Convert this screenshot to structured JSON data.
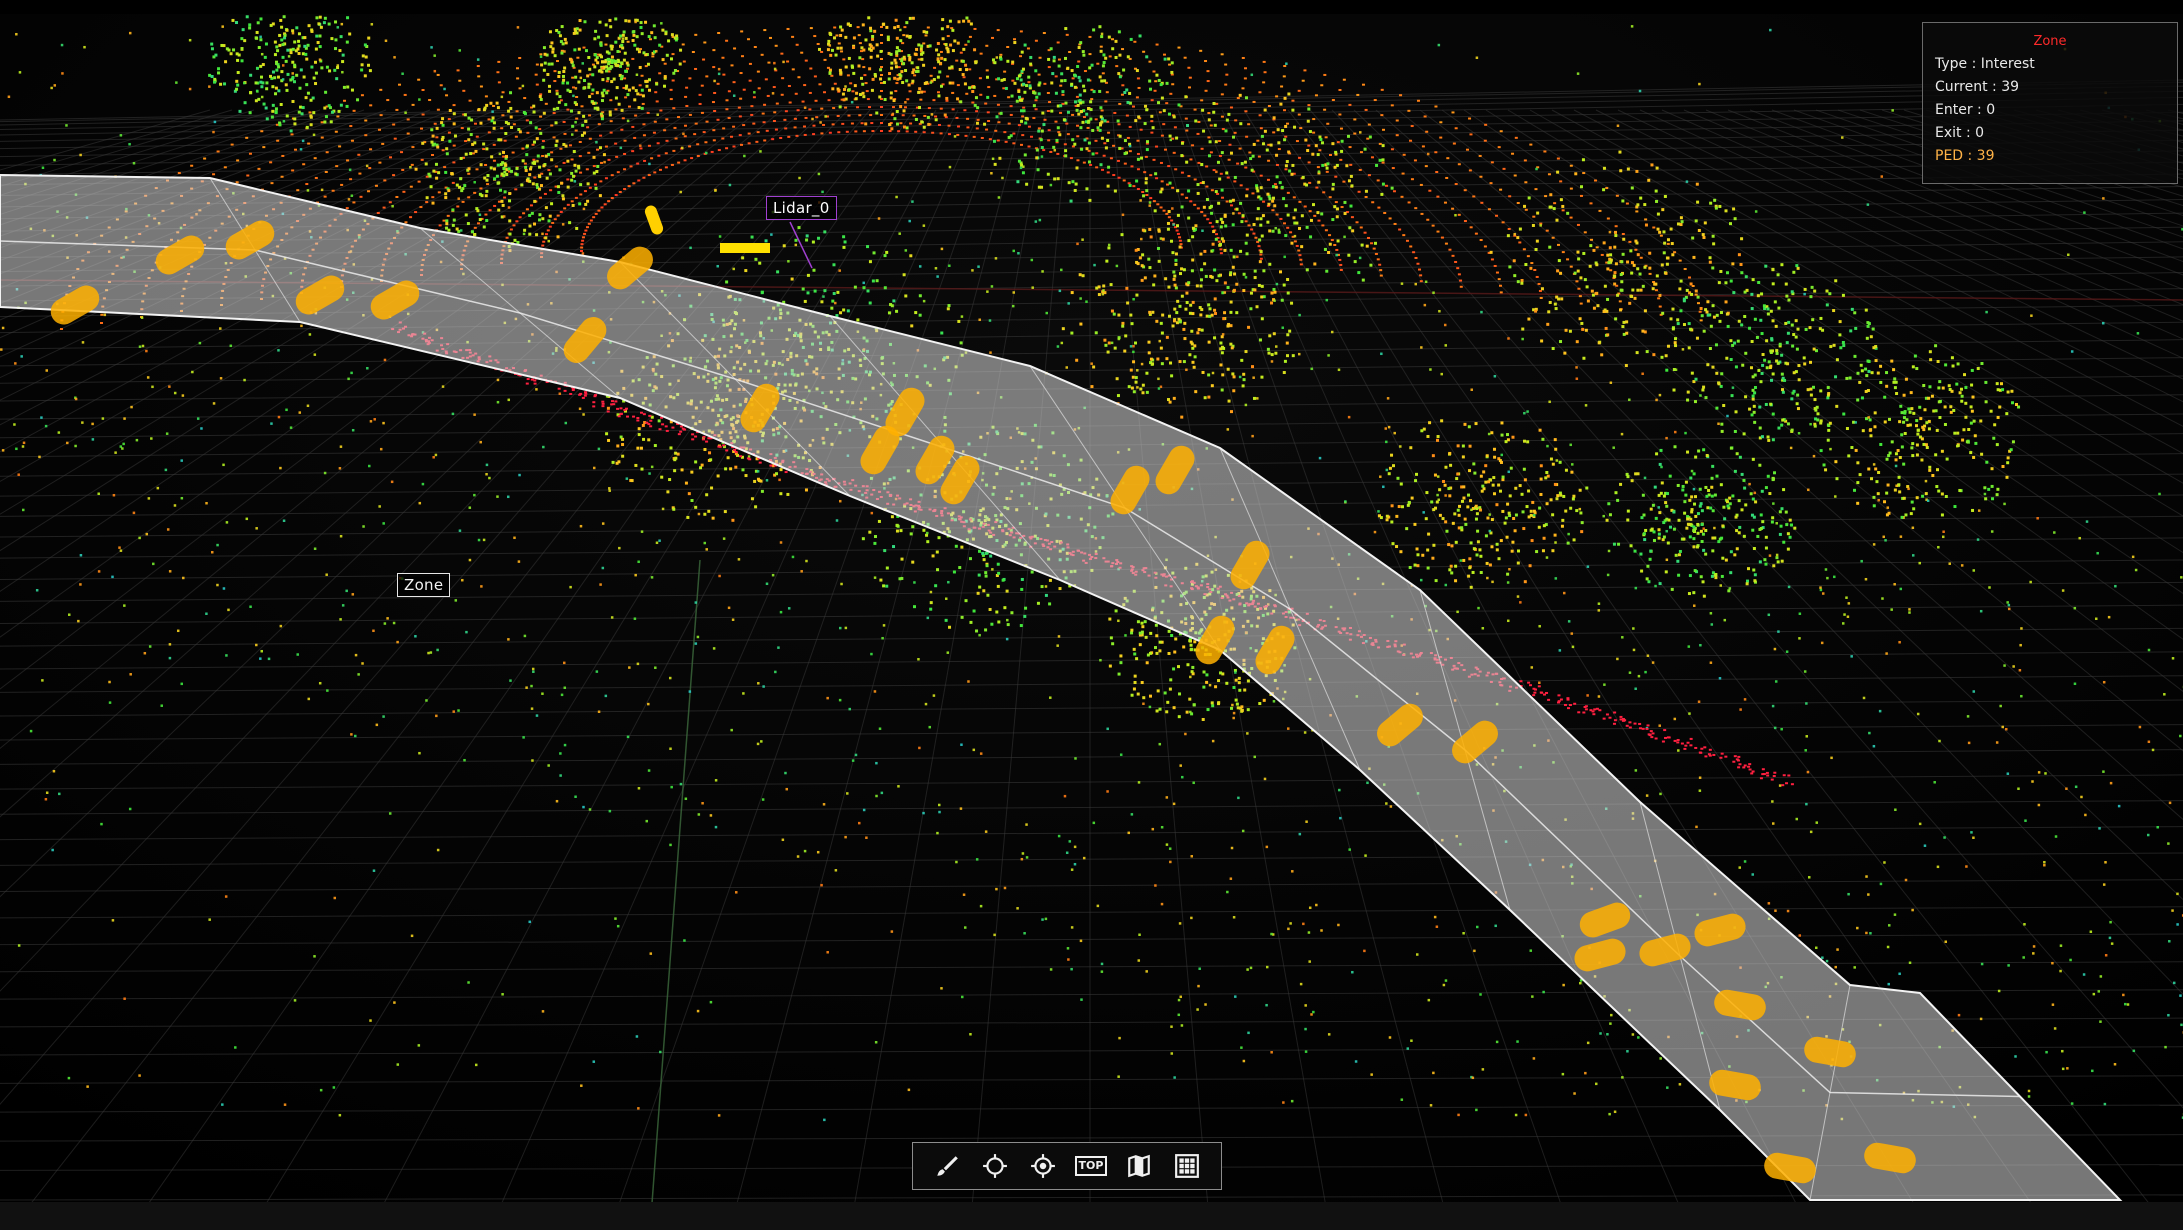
{
  "viewport": {
    "name": "lidar-3d-view"
  },
  "labels": {
    "zone": "Zone",
    "lidar": "Lidar_0"
  },
  "info_panel": {
    "title": "Zone",
    "type": "Type : Interest",
    "current": "Current : 39",
    "enter": "Enter : 0",
    "exit": "Exit : 0",
    "ped": "PED : 39"
  },
  "toolbar": {
    "tools": [
      {
        "name": "brush-tool-icon",
        "icon": "brush-icon"
      },
      {
        "name": "crosshair-tool-icon",
        "icon": "crosshair-icon"
      },
      {
        "name": "target-tool-icon",
        "icon": "target-icon"
      },
      {
        "name": "top-view-button",
        "label": "TOP"
      },
      {
        "name": "map-tool-icon",
        "icon": "map-icon"
      },
      {
        "name": "grid-tool-icon",
        "icon": "grid-icon"
      }
    ]
  },
  "colors": {
    "background": "#030303",
    "grid": "#3a3a3a",
    "zone_fill": "#d8d8d8",
    "pedestrian": "#ffb000",
    "zone_title": "#ff2a2a",
    "ped_text": "#ffb347"
  },
  "zone_stats": {
    "current": 39,
    "enter": 0,
    "exit": 0,
    "ped": 39
  }
}
